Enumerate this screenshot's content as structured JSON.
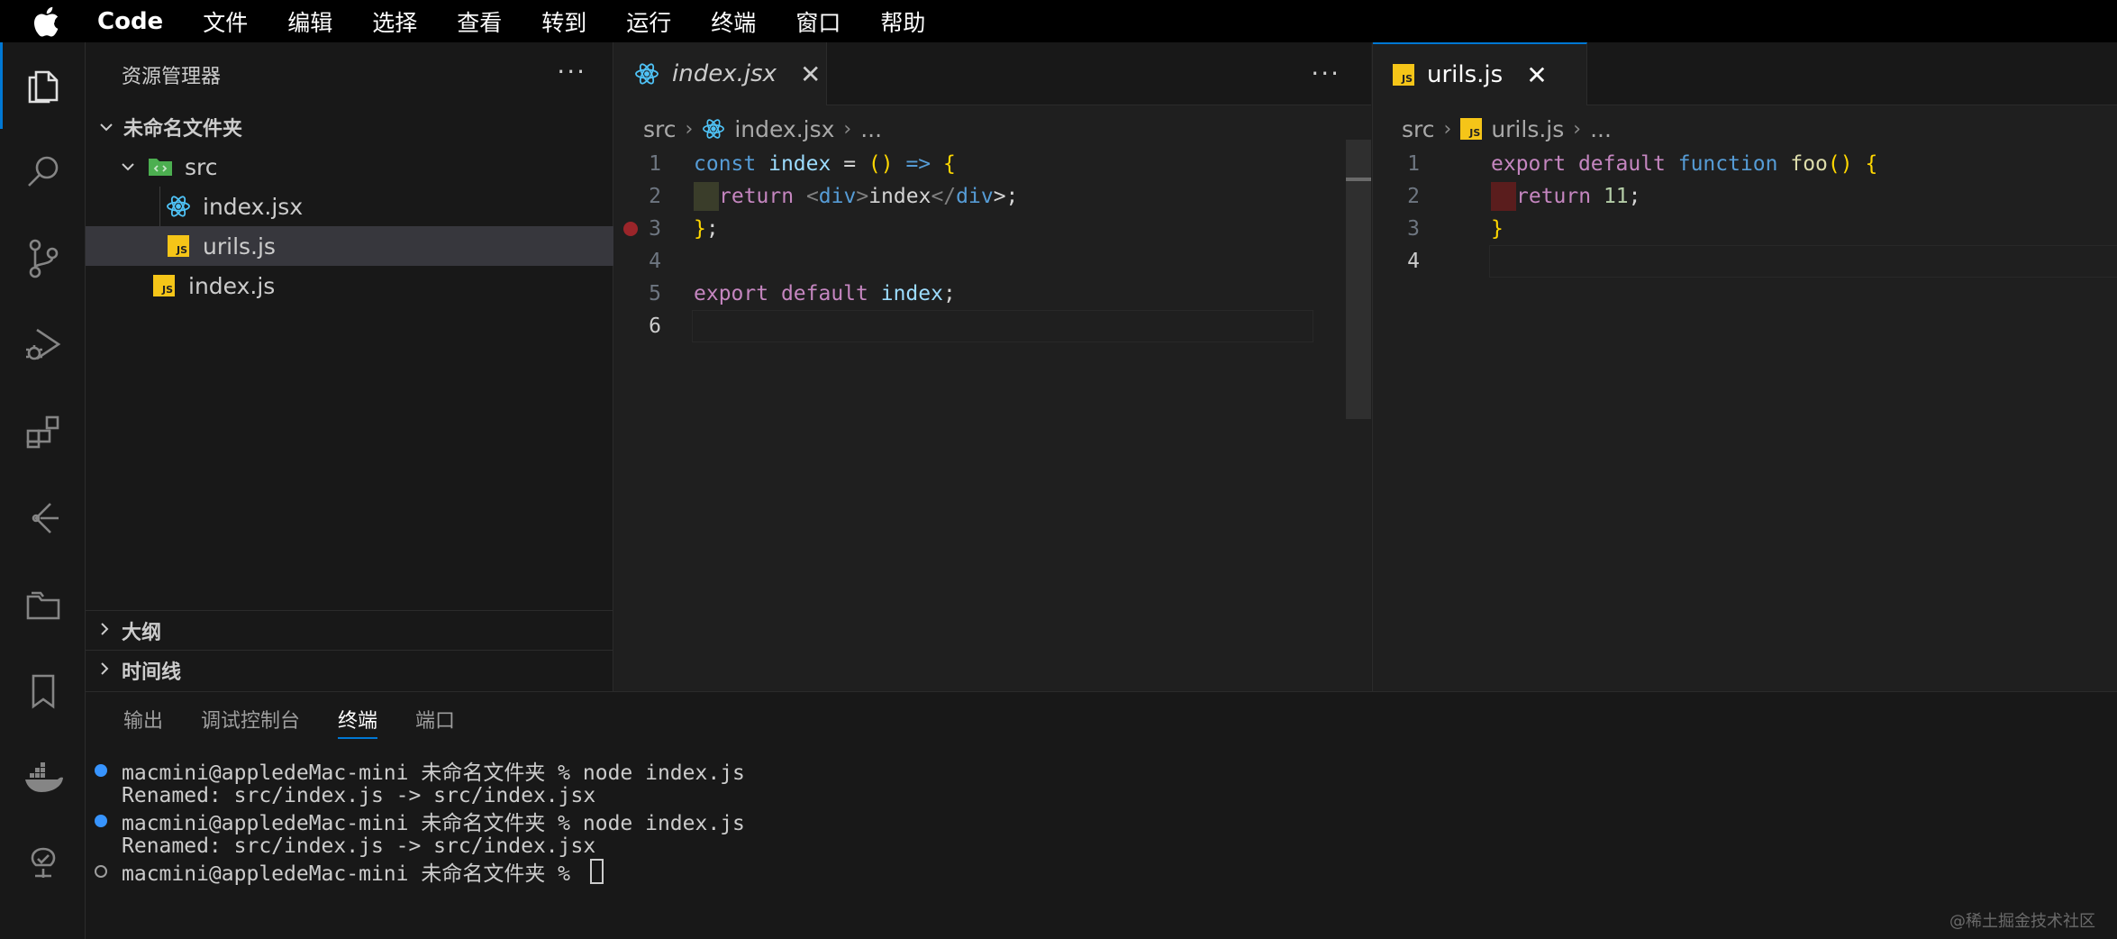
{
  "menubar": {
    "app_name": "Code",
    "items": [
      "文件",
      "编辑",
      "选择",
      "查看",
      "转到",
      "运行",
      "终端",
      "窗口",
      "帮助"
    ]
  },
  "activity_bar": {
    "icons": [
      "explorer-icon",
      "search-icon",
      "source-control-icon",
      "run-debug-icon",
      "extensions-icon",
      "gitlens-icon",
      "folders-icon",
      "bookmarks-icon",
      "docker-icon",
      "testing-icon"
    ]
  },
  "sidebar": {
    "title": "资源管理器",
    "more": "···",
    "folder": "未命名文件夹",
    "tree": [
      {
        "label": "src"
      },
      {
        "label": "index.jsx"
      },
      {
        "label": "urils.js"
      },
      {
        "label": "index.js"
      }
    ],
    "outline": "大纲",
    "timeline": "时间线"
  },
  "editor_left": {
    "tab_label": "index.jsx",
    "close": "✕",
    "more": "···",
    "breadcrumb": {
      "folder": "src",
      "file": "index.jsx",
      "ellipsis": "..."
    },
    "lines": [
      {
        "num": "1"
      },
      {
        "num": "2"
      },
      {
        "num": "3"
      },
      {
        "num": "4"
      },
      {
        "num": "5"
      },
      {
        "num": "6"
      }
    ],
    "code": {
      "l1": {
        "k": "const",
        "v": "index",
        "eq": " = ",
        "paren": "()",
        "arrow": " => ",
        "brace": "{"
      },
      "l2": {
        "k": "return",
        "lt": " <",
        "tag": "div",
        "gt": ">",
        "text": "index",
        "lt2": "</",
        "tag2": "div",
        "gt2": ">;"
      },
      "l3": {
        "brace": "}",
        "semi": ";"
      },
      "l5": {
        "k1": "export",
        "k2": " default",
        "v": " index",
        "semi": ";"
      }
    }
  },
  "editor_right": {
    "tab_label": "urils.js",
    "close": "✕",
    "breadcrumb": {
      "folder": "src",
      "file": "urils.js",
      "ellipsis": "..."
    },
    "lines": [
      {
        "num": "1"
      },
      {
        "num": "2"
      },
      {
        "num": "3"
      },
      {
        "num": "4"
      }
    ],
    "code": {
      "l1": {
        "k1": "export",
        "k2": " default",
        "k3": " function",
        "fn": " foo",
        "paren": "()",
        "brace": " {"
      },
      "l2": {
        "k": "return",
        "num": " 11",
        "semi": ";"
      },
      "l3": {
        "brace": "}"
      }
    }
  },
  "panel": {
    "tabs": [
      "输出",
      "调试控制台",
      "终端",
      "端口"
    ],
    "terminal": [
      "macmini@appledeMac-mini 未命名文件夹 % node index.js",
      "Renamed: src/index.js -> src/index.jsx",
      "macmini@appledeMac-mini 未命名文件夹 % node index.js",
      "Renamed: src/index.js -> src/index.jsx",
      "macmini@appledeMac-mini 未命名文件夹 % "
    ]
  },
  "watermark": "@稀土掘金技术社区",
  "colors": {
    "accent": "#0078d4",
    "js_badge": "#f5c518",
    "react": "#4fc3f7",
    "breakpoint": "#c5282f"
  }
}
